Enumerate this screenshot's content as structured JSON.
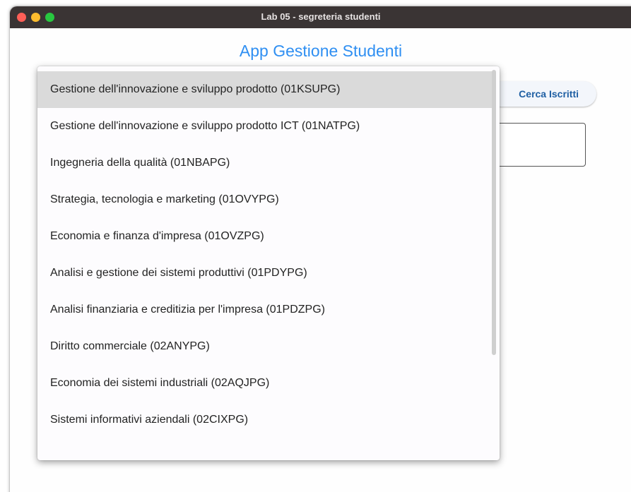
{
  "window": {
    "title": "Lab 05 - segreteria studenti"
  },
  "app": {
    "title": "App Gestione Studenti",
    "search_button_label": "Cerca Iscritti"
  },
  "dropdown": {
    "selected_index": 0,
    "options": [
      "Gestione dell'innovazione e sviluppo prodotto (01KSUPG)",
      "Gestione dell'innovazione e sviluppo prodotto ICT (01NATPG)",
      "Ingegneria della qualità (01NBAPG)",
      "Strategia, tecnologia e marketing (01OVYPG)",
      "Economia e finanza d'impresa (01OVZPG)",
      "Analisi e gestione dei sistemi produttivi (01PDYPG)",
      "Analisi finanziaria e creditizia per l'impresa (01PDZPG)",
      "Diritto commerciale (02ANYPG)",
      "Economia dei sistemi industriali (02AQJPG)",
      "Sistemi informativi aziendali (02CIXPG)"
    ]
  },
  "colors": {
    "title_blue": "#2f8ff2",
    "button_text": "#1f5fa3",
    "selected_bg": "#dadada"
  }
}
